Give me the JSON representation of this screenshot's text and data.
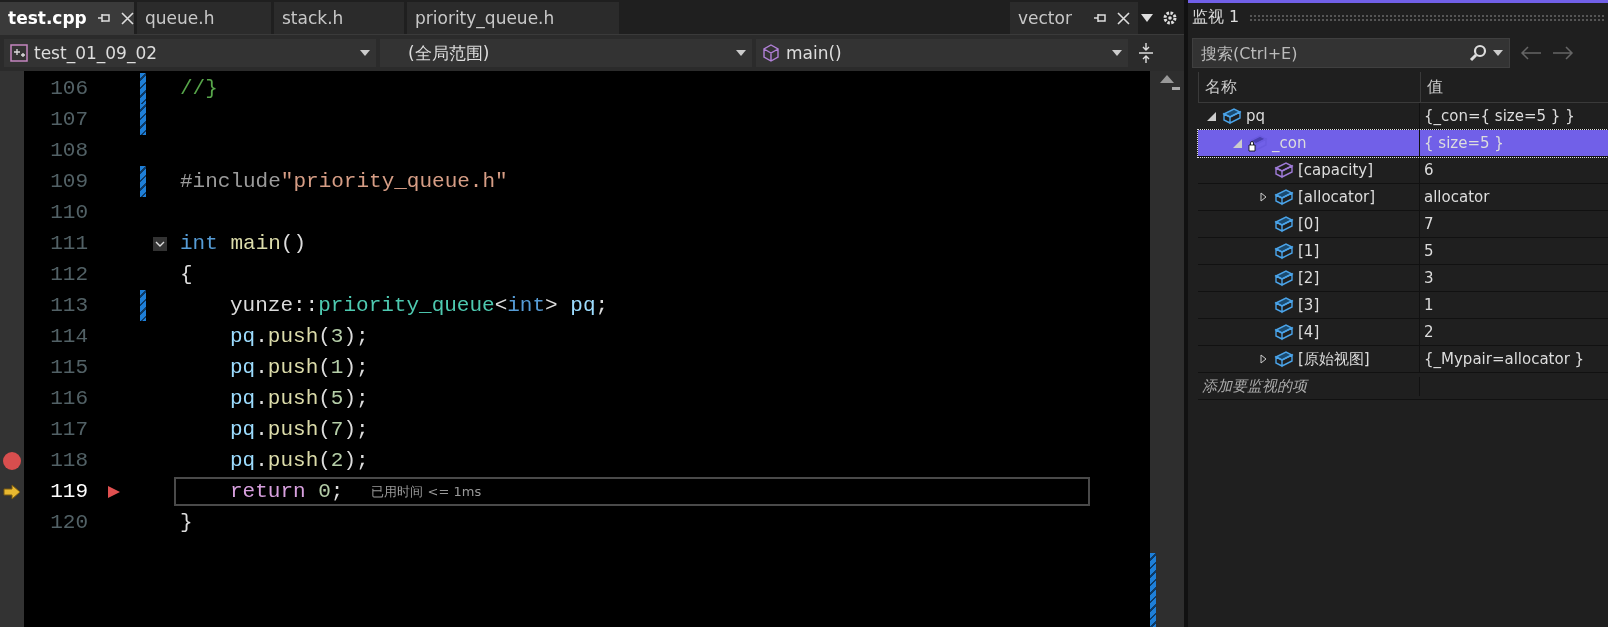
{
  "tabs": [
    {
      "label": "test.cpp",
      "selected": true,
      "pinned": true
    },
    {
      "label": "queue.h",
      "selected": false,
      "pinned": false
    },
    {
      "label": "stack.h",
      "selected": false,
      "pinned": false
    },
    {
      "label": "priority_queue.h",
      "selected": false,
      "pinned": false
    }
  ],
  "preview_tab": {
    "label": "vector"
  },
  "nav_bar": {
    "project": "test_01_09_02",
    "scope": "(全局范围)",
    "member": "main()"
  },
  "code_lines": [
    {
      "number": "106",
      "changed": true,
      "breakpoint": false,
      "current": false,
      "indented": false,
      "tokens": [
        {
          "text": "//}",
          "kind": "comment"
        }
      ]
    },
    {
      "number": "107",
      "changed": true,
      "breakpoint": false,
      "current": false,
      "indented": false
    },
    {
      "number": "108",
      "changed": false,
      "breakpoint": false,
      "current": false,
      "indented": false
    },
    {
      "number": "109",
      "changed": true,
      "breakpoint": false,
      "current": false,
      "indented": false,
      "tokens": [
        {
          "text": "#include",
          "kind": "preproc"
        },
        {
          "text": "\"priority_queue.h\"",
          "kind": "string"
        }
      ]
    },
    {
      "number": "110",
      "changed": false,
      "breakpoint": false,
      "current": false,
      "indented": false
    },
    {
      "number": "111",
      "changed": false,
      "breakpoint": false,
      "current": false,
      "indented": false,
      "fold": true,
      "tokens": [
        {
          "text": "int ",
          "kind": "keyword"
        },
        {
          "text": "main",
          "kind": "function"
        },
        {
          "text": "()",
          "kind": "plain"
        }
      ]
    },
    {
      "number": "112",
      "changed": false,
      "breakpoint": false,
      "current": false,
      "indented": false,
      "tokens": [
        {
          "text": "{",
          "kind": "plain"
        }
      ]
    },
    {
      "number": "113",
      "changed": true,
      "breakpoint": false,
      "current": false,
      "indented": true,
      "tokens": [
        {
          "text": "yunze::",
          "kind": "plain"
        },
        {
          "text": "priority_queue",
          "kind": "type"
        },
        {
          "text": "<",
          "kind": "plain"
        },
        {
          "text": "int",
          "kind": "keyword"
        },
        {
          "text": "> ",
          "kind": "plain"
        },
        {
          "text": "pq",
          "kind": "variable"
        },
        {
          "text": ";",
          "kind": "plain"
        }
      ]
    },
    {
      "number": "114",
      "changed": false,
      "breakpoint": false,
      "current": false,
      "indented": true,
      "tokens": [
        {
          "text": "pq",
          "kind": "variable"
        },
        {
          "text": ".",
          "kind": "plain"
        },
        {
          "text": "push",
          "kind": "function"
        },
        {
          "text": "(",
          "kind": "plain"
        },
        {
          "text": "3",
          "kind": "number"
        },
        {
          "text": ");",
          "kind": "plain"
        }
      ]
    },
    {
      "number": "115",
      "changed": false,
      "breakpoint": false,
      "current": false,
      "indented": true,
      "tokens": [
        {
          "text": "pq",
          "kind": "variable"
        },
        {
          "text": ".",
          "kind": "plain"
        },
        {
          "text": "push",
          "kind": "function"
        },
        {
          "text": "(",
          "kind": "plain"
        },
        {
          "text": "1",
          "kind": "number"
        },
        {
          "text": ");",
          "kind": "plain"
        }
      ]
    },
    {
      "number": "116",
      "changed": false,
      "breakpoint": false,
      "current": false,
      "indented": true,
      "tokens": [
        {
          "text": "pq",
          "kind": "variable"
        },
        {
          "text": ".",
          "kind": "plain"
        },
        {
          "text": "push",
          "kind": "function"
        },
        {
          "text": "(",
          "kind": "plain"
        },
        {
          "text": "5",
          "kind": "number"
        },
        {
          "text": ");",
          "kind": "plain"
        }
      ]
    },
    {
      "number": "117",
      "changed": false,
      "breakpoint": false,
      "current": false,
      "indented": true,
      "tokens": [
        {
          "text": "pq",
          "kind": "variable"
        },
        {
          "text": ".",
          "kind": "plain"
        },
        {
          "text": "push",
          "kind": "function"
        },
        {
          "text": "(",
          "kind": "plain"
        },
        {
          "text": "7",
          "kind": "number"
        },
        {
          "text": ");",
          "kind": "plain"
        }
      ]
    },
    {
      "number": "118",
      "changed": false,
      "breakpoint": true,
      "current": false,
      "indented": true,
      "tokens": [
        {
          "text": "pq",
          "kind": "variable"
        },
        {
          "text": ".",
          "kind": "plain"
        },
        {
          "text": "push",
          "kind": "function"
        },
        {
          "text": "(",
          "kind": "plain"
        },
        {
          "text": "2",
          "kind": "number"
        },
        {
          "text": ");",
          "kind": "plain"
        }
      ]
    },
    {
      "number": "119",
      "changed": false,
      "breakpoint": false,
      "current": true,
      "indented": true,
      "perf_tip": "已用时间 <= 1ms",
      "tokens": [
        {
          "text": "return ",
          "kind": "control"
        },
        {
          "text": "0",
          "kind": "number"
        },
        {
          "text": ";",
          "kind": "plain"
        }
      ]
    },
    {
      "number": "120",
      "changed": false,
      "breakpoint": false,
      "current": false,
      "indented": false,
      "tokens": [
        {
          "text": "}",
          "kind": "plain"
        }
      ]
    }
  ],
  "watch": {
    "title": "监视 1",
    "search": {
      "placeholder": "搜索(Ctrl+E)"
    },
    "columns": [
      "名称",
      "值"
    ],
    "items": [
      {
        "name": "pq",
        "value": "{_con={ size=5 } }",
        "kind": "object",
        "expanded": true,
        "selected": false,
        "children": [
          {
            "name": "_con",
            "value": "{ size=5 }",
            "kind": "private",
            "expanded": true,
            "selected": true,
            "children": [
              {
                "name": "[capacity]",
                "value": "6",
                "kind": "property",
                "selected": false
              },
              {
                "name": "[allocator]",
                "value": "allocator",
                "kind": "object",
                "expanded": false,
                "selected": false
              },
              {
                "name": "[0]",
                "value": "7",
                "kind": "object",
                "selected": false
              },
              {
                "name": "[1]",
                "value": "5",
                "kind": "object",
                "selected": false
              },
              {
                "name": "[2]",
                "value": "3",
                "kind": "object",
                "selected": false
              },
              {
                "name": "[3]",
                "value": "1",
                "kind": "object",
                "selected": false
              },
              {
                "name": "[4]",
                "value": "2",
                "kind": "object",
                "selected": false
              },
              {
                "name": "[原始视图]",
                "value": "{_Mypair=allocator }",
                "kind": "object",
                "expanded": false,
                "selected": false
              }
            ]
          }
        ]
      }
    ],
    "add_item": "添加要监视的项"
  }
}
